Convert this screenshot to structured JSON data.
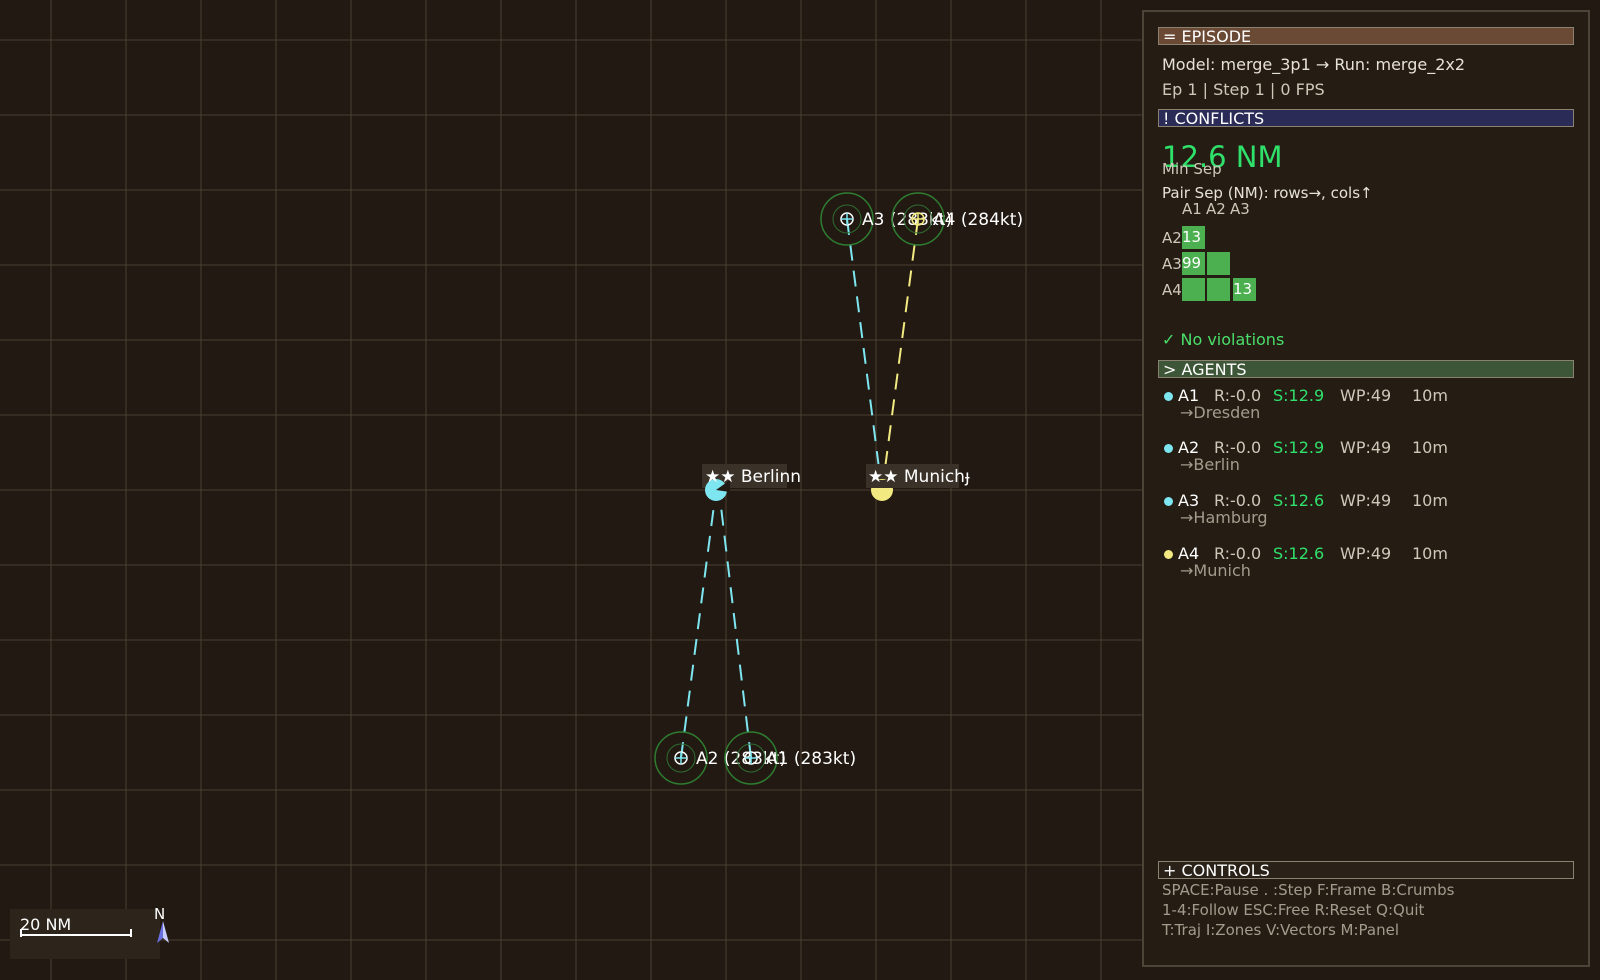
{
  "map": {
    "aircraft": [
      {
        "id": "A1",
        "label": "A1 (283kt)",
        "color": "#7ee6f0"
      },
      {
        "id": "A2",
        "label": "A2 (283kt)",
        "color": "#7ee6f0"
      },
      {
        "id": "A3",
        "label": "A3 (283kt)",
        "color": "#7ee6f0"
      },
      {
        "id": "A4",
        "label": "A4 (284kt)",
        "color": "#f2ea80"
      }
    ],
    "cities": [
      {
        "name": "★★ Berlinn",
        "color": "#7ee6f0"
      },
      {
        "name": "★★ Munichɟ",
        "color": "#f2ea80"
      }
    ],
    "scale_label": "20 NM",
    "compass_label": "N"
  },
  "panel": {
    "episode_header": "= EPISODE",
    "model_line": "Model: merge_3p1 → Run: merge_2x2",
    "ep_line": "Ep 1 | Step 1 | 0 FPS",
    "conflicts_header": "! CONFLICTS",
    "min_sep_value": "12.6 NM",
    "min_sep_label": "Min Sep",
    "pair_sep_label": "Pair Sep (NM):  rows→, cols↑",
    "matrix": {
      "cols": [
        "A1",
        "A2",
        "A3"
      ],
      "rows": [
        "A2",
        "A3",
        "A4"
      ],
      "cells": [
        [
          "13",
          "",
          ""
        ],
        [
          "99",
          "",
          ""
        ],
        [
          "",
          "",
          "13"
        ]
      ]
    },
    "no_violations": "✓ No violations",
    "agents_header": "> AGENTS",
    "agents": [
      {
        "id": "A1",
        "reward": "R:-0.0",
        "sep": "S:12.9",
        "wp": "WP:49",
        "eta": "10m",
        "dest": "→Dresden",
        "color": "#7ee6f0"
      },
      {
        "id": "A2",
        "reward": "R:-0.0",
        "sep": "S:12.9",
        "wp": "WP:49",
        "eta": "10m",
        "dest": "→Berlin",
        "color": "#7ee6f0"
      },
      {
        "id": "A3",
        "reward": "R:-0.0",
        "sep": "S:12.6",
        "wp": "WP:49",
        "eta": "10m",
        "dest": "→Hamburg",
        "color": "#7ee6f0"
      },
      {
        "id": "A4",
        "reward": "R:-0.0",
        "sep": "S:12.6",
        "wp": "WP:49",
        "eta": "10m",
        "dest": "→Munich",
        "color": "#f2ea80"
      }
    ],
    "controls_header": "+ CONTROLS",
    "controls": [
      "SPACE:Pause . :Step F:Frame B:Crumbs",
      "1-4:Follow ESC:Free R:Reset Q:Quit",
      "T:Traj I:Zones V:Vectors M:Panel"
    ]
  }
}
